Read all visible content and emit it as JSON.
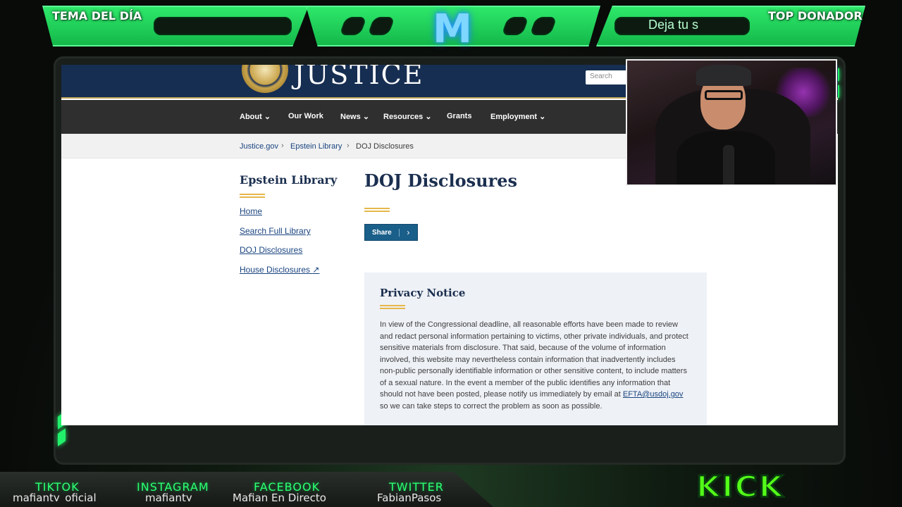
{
  "overlay": {
    "topic_label": "TEMA DEL DÍA",
    "top_donor_label": "TOP DONADOR",
    "donor_ticker": "Deja tu s",
    "logo_letter": "M",
    "kick_label": "KICK",
    "colors": {
      "accent": "#22f06a",
      "kick": "#53fc18"
    }
  },
  "site": {
    "header_word": "JUSTICE",
    "search_placeholder": "Search",
    "nav": [
      "About",
      "Our Work",
      "News",
      "Resources",
      "Grants",
      "Employment"
    ],
    "nav_dropdown_icon": "chevron-down-icon",
    "breadcrumb": [
      "Justice.gov",
      "Epstein Library",
      "DOJ Disclosures"
    ],
    "sidebar": {
      "title": "Epstein Library",
      "links": [
        "Home",
        "Search Full Library",
        "DOJ Disclosures",
        "House Disclosures"
      ]
    },
    "page_title": "DOJ Disclosures",
    "share_label": "Share",
    "privacy": {
      "title": "Privacy Notice",
      "body_before_email": "In view of the Congressional deadline, all reasonable efforts have been made to review and redact personal information pertaining to victims, other private individuals, and protect sensitive materials from disclosure. That said, because of the volume of information involved, this website may nevertheless contain information that inadvertently includes non-public personally identifiable information or other sensitive content, to include matters of a sexual nature. In the event a member of the public identifies any information that should not have been posted, please notify us immediately by email at ",
      "email": "EFTA@usdoj.gov",
      "body_after_email": " so we can take steps to correct the problem as soon as possible."
    },
    "colors": {
      "header": "#162e51",
      "nav": "#2f2f2f",
      "link": "#1a4480",
      "gold": "#e6b74a"
    }
  },
  "socials": [
    {
      "name": "TIKTOK",
      "handle": "mafianty_oficial"
    },
    {
      "name": "INSTAGRAM",
      "handle": "mafianty"
    },
    {
      "name": "FACEBOOK",
      "handle": "Mafian En Directo"
    },
    {
      "name": "TWITTER",
      "handle": "FabianPasos"
    }
  ]
}
